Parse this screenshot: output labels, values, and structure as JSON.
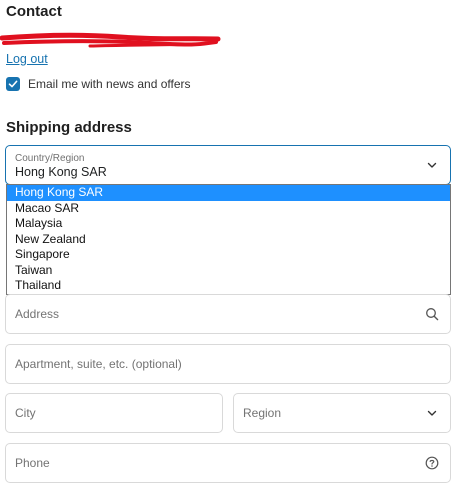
{
  "contact": {
    "heading": "Contact",
    "logout_label": "Log out",
    "email_opt_in": {
      "label": "Email me with news and offers",
      "checked": true
    }
  },
  "shipping": {
    "heading": "Shipping address",
    "country": {
      "label": "Country/Region",
      "selected_value": "Hong Kong SAR",
      "options": [
        "Hong Kong SAR",
        "Macao SAR",
        "Malaysia",
        "New Zealand",
        "Singapore",
        "Taiwan",
        "Thailand"
      ]
    },
    "address_placeholder": "Address",
    "apartment_placeholder": "Apartment, suite, etc. (optional)",
    "city_placeholder": "City",
    "region_placeholder": "Region",
    "phone_placeholder": "Phone"
  },
  "colors": {
    "accent": "#1773b0",
    "selected_option": "#1e90ff",
    "redaction": "#e0101f"
  },
  "icons": {
    "search": "search-icon",
    "chevron": "chevron-down-icon",
    "help": "help-circle-icon",
    "check": "checkmark-icon"
  }
}
